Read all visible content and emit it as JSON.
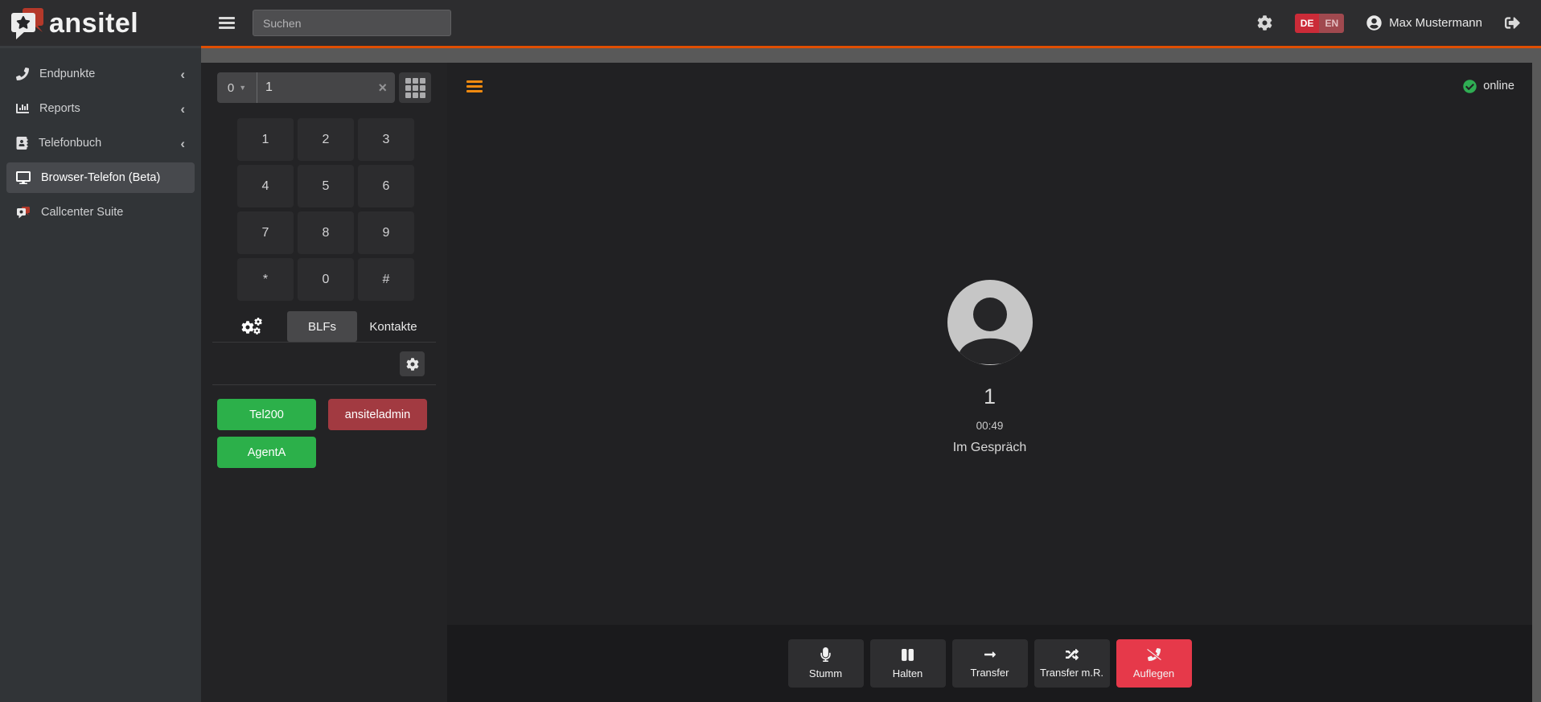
{
  "topbar": {
    "logo_text": "ansitel",
    "search_placeholder": "Suchen",
    "languages": {
      "de": "DE",
      "en": "EN"
    },
    "user_name": "Max Mustermann"
  },
  "sidebar": {
    "items": [
      {
        "label": "Endpunkte",
        "icon": "phone-icon",
        "expandable": true
      },
      {
        "label": "Reports",
        "icon": "chart-bar-icon",
        "expandable": true
      },
      {
        "label": "Telefonbuch",
        "icon": "address-book-icon",
        "expandable": true
      },
      {
        "label": "Browser-Telefon (Beta)",
        "icon": "desktop-icon",
        "active": true
      },
      {
        "label": "Callcenter Suite",
        "icon": "callcenter-logo-icon",
        "active": false
      }
    ]
  },
  "dialer": {
    "prefix_value": "0",
    "number_value": "1",
    "clear_glyph": "×",
    "keys": [
      "1",
      "2",
      "3",
      "4",
      "5",
      "6",
      "7",
      "8",
      "9",
      "*",
      "0",
      "#"
    ],
    "tabs": {
      "blfs": "BLFs",
      "kontakte": "Kontakte"
    },
    "blf_buttons": [
      {
        "label": "Tel200",
        "state_color": "#2cb04a"
      },
      {
        "label": "ansiteladmin",
        "state_color": "#a23a41"
      },
      {
        "label": "AgentA",
        "state_color": "#2cb04a"
      }
    ]
  },
  "call": {
    "connection_status": "online",
    "caller_id": "1",
    "duration": "00:49",
    "call_state": "Im Gespräch",
    "controls": [
      {
        "label": "Stumm",
        "icon": "microphone-icon"
      },
      {
        "label": "Halten",
        "icon": "pause-icon"
      },
      {
        "label": "Transfer",
        "icon": "arrow-right-icon"
      },
      {
        "label": "Transfer m.R.",
        "icon": "shuffle-icon"
      },
      {
        "label": "Auflegen",
        "icon": "phone-slash-icon",
        "danger": true
      }
    ]
  },
  "colors": {
    "accent_orange": "#e04e00",
    "hamburger_orange": "#f08a10",
    "free_green": "#2cb04a",
    "busy_red": "#a23a41",
    "hangup_red": "#e6394a",
    "online_green": "#2fad53",
    "lang_de_bg": "#cb2b38",
    "lang_en_bg": "#a0494f"
  }
}
